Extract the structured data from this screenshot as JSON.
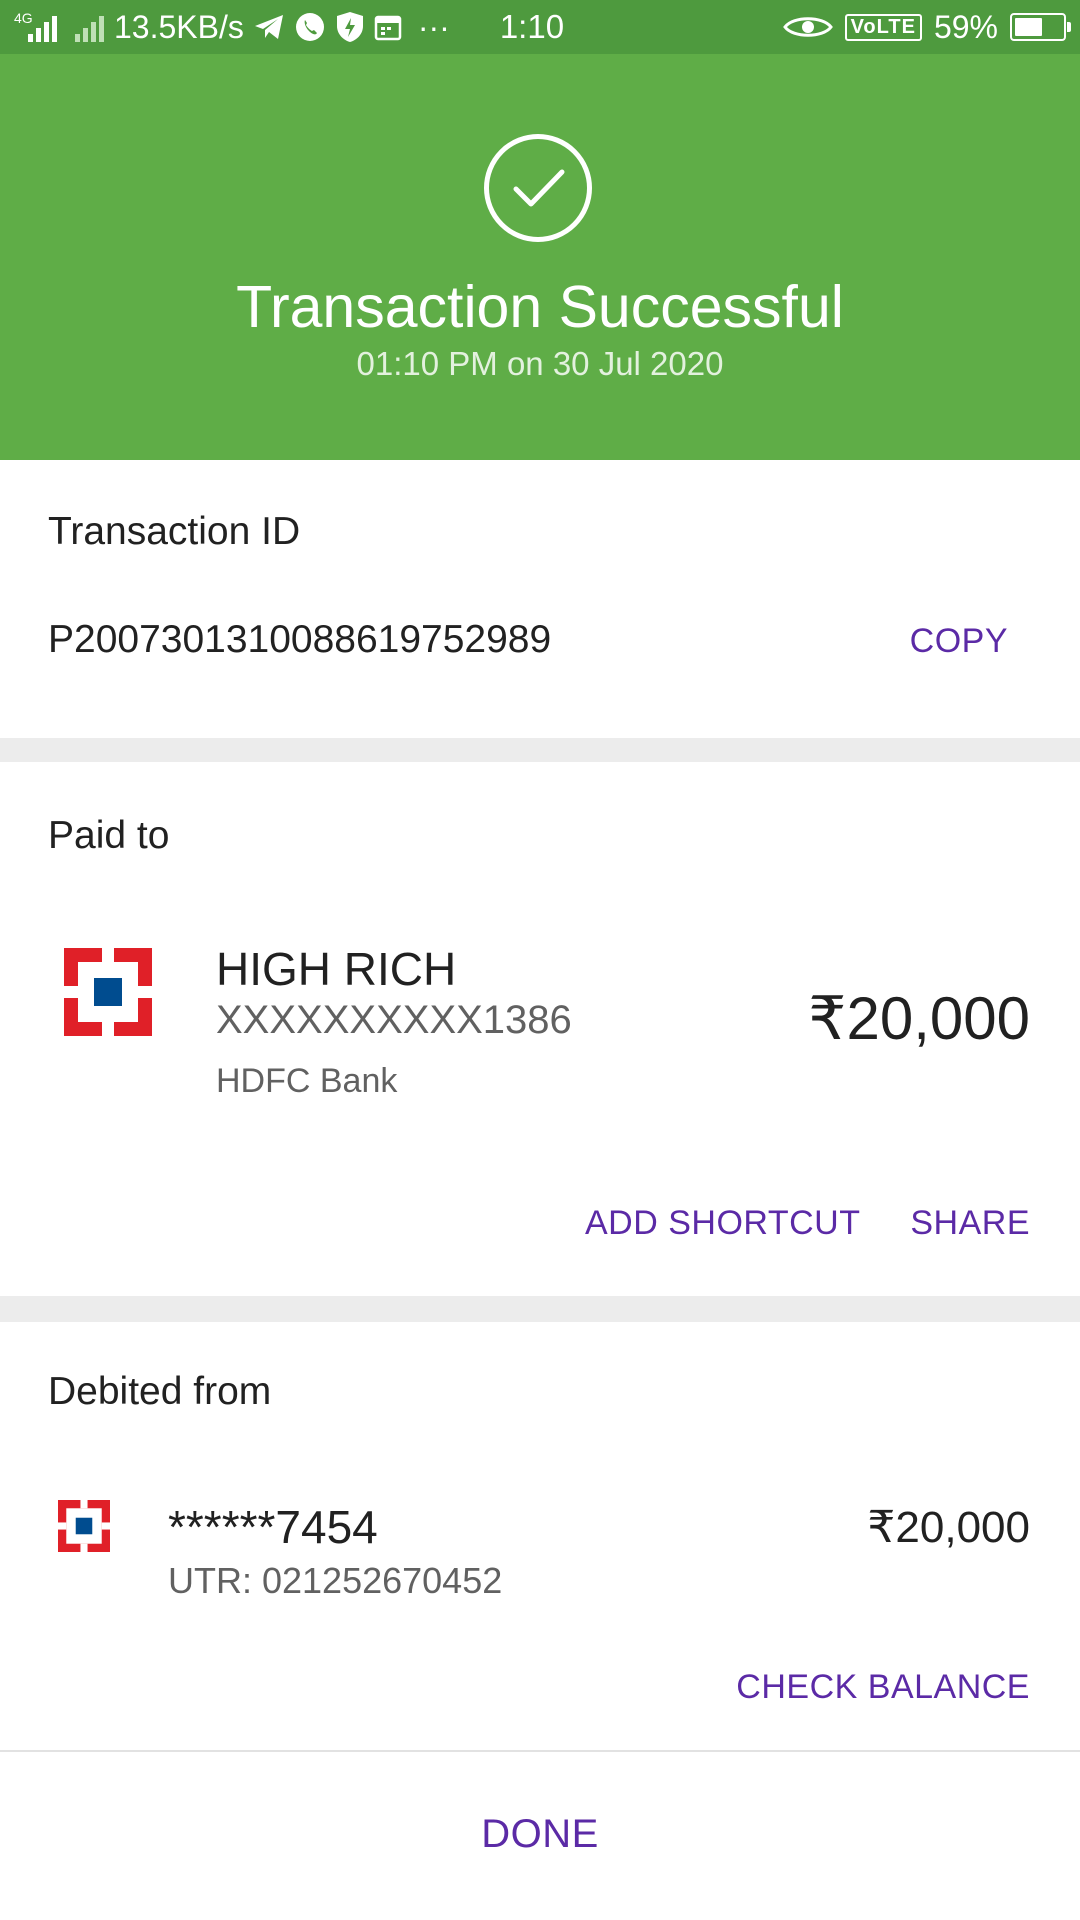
{
  "status_bar": {
    "network": "4G",
    "speed": "13.5KB/s",
    "time": "1:10",
    "overflow": "···",
    "volte": "VoLTE",
    "battery_percent": "59%",
    "battery_level": 0.59,
    "icons": [
      "signal-icon",
      "signal-icon",
      "telegram-icon",
      "whatsapp-icon",
      "shield-icon",
      "calendar-icon",
      "eye-icon",
      "battery-icon"
    ]
  },
  "hero": {
    "title": "Transaction Successful",
    "subtitle": "01:10 PM on 30 Jul 2020",
    "icon": "check-circle-icon",
    "color": "#5fad47"
  },
  "transaction": {
    "label": "Transaction ID",
    "id": "P2007301310088619752989",
    "copy_label": "COPY"
  },
  "paid_to": {
    "label": "Paid to",
    "name": "HIGH RICH",
    "account": "XXXXXXXXXX1386",
    "bank": "HDFC Bank",
    "amount": "₹20,000",
    "bank_icon": "hdfc-logo-icon",
    "add_shortcut_label": "ADD SHORTCUT",
    "share_label": "SHARE"
  },
  "debited_from": {
    "label": "Debited from",
    "account": "******7454",
    "utr": "UTR: 021252670452",
    "amount": "₹20,000",
    "bank_icon": "hdfc-logo-icon",
    "check_balance_label": "CHECK BALANCE"
  },
  "footer": {
    "done_label": "DONE"
  },
  "colors": {
    "accent": "#5b2aa6",
    "success": "#5fad47",
    "hdfc_red": "#e02028",
    "hdfc_blue": "#004c8f"
  }
}
